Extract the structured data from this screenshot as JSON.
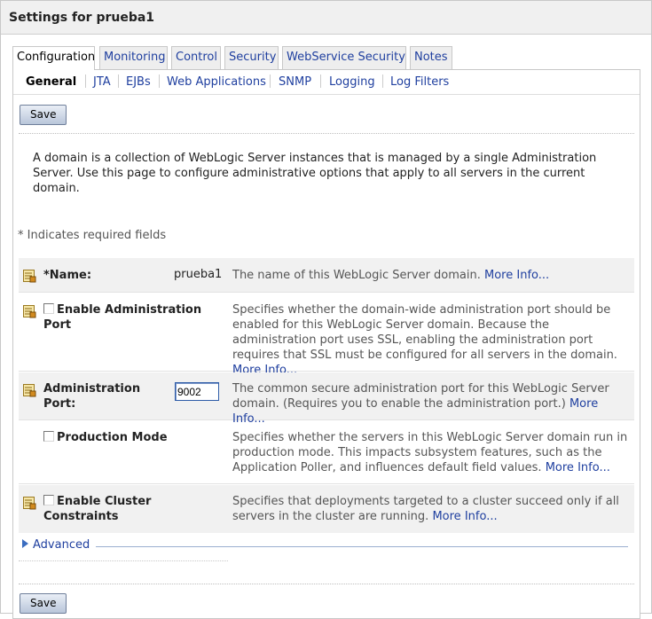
{
  "page": {
    "title": "Settings for prueba1"
  },
  "tabs": [
    {
      "label": "Configuration",
      "active": true
    },
    {
      "label": "Monitoring",
      "active": false
    },
    {
      "label": "Control",
      "active": false
    },
    {
      "label": "Security",
      "active": false
    },
    {
      "label": "WebService Security",
      "active": false
    },
    {
      "label": "Notes",
      "active": false
    }
  ],
  "subtabs": [
    {
      "label": "General",
      "active": true
    },
    {
      "label": "JTA",
      "active": false
    },
    {
      "label": "EJBs",
      "active": false
    },
    {
      "label": "Web Applications",
      "active": false
    },
    {
      "label": "SNMP",
      "active": false
    },
    {
      "label": "Logging",
      "active": false
    },
    {
      "label": "Log Filters",
      "active": false
    }
  ],
  "actions": {
    "save_top": "Save",
    "save_bottom": "Save"
  },
  "intro": "A domain is a collection of WebLogic Server instances that is managed by a single Administration Server. Use this page to configure administrative options that apply to all servers in the current domain.",
  "required_note": "* Indicates required fields",
  "fields": {
    "name": {
      "label": "*Name:",
      "value": "prueba1",
      "description": "The name of this WebLogic Server domain.",
      "more": "More Info..."
    },
    "enable_admin_port": {
      "label": "Enable Administration Port",
      "checked": false,
      "description": "Specifies whether the domain-wide administration port should be enabled for this WebLogic Server domain. Because the administration port uses SSL, enabling the administration port requires that SSL must be configured for all servers in the domain.",
      "more": "More Info..."
    },
    "admin_port": {
      "label": "Administration Port:",
      "value": "9002",
      "description": "The common secure administration port for this WebLogic Server domain. (Requires you to enable the administration port.)",
      "more": "More Info..."
    },
    "production_mode": {
      "label": "Production Mode",
      "checked": false,
      "description": "Specifies whether the servers in this WebLogic Server domain run in production mode. This impacts subsystem features, such as the Application Poller, and influences default field values.",
      "more": "More Info..."
    },
    "cluster_constraints": {
      "label": "Enable Cluster Constraints",
      "checked": false,
      "description": "Specifies that deployments targeted to a cluster succeed only if all servers in the cluster are running.",
      "more": "More Info..."
    }
  },
  "advanced": {
    "label": "Advanced"
  },
  "icons": {
    "row_icon": "lock-edit-icon",
    "expand": "triangle-right-icon"
  },
  "colors": {
    "link": "#1f3f9f",
    "input_border": "#2e5ca8",
    "row_shade": "#f1f1f1"
  }
}
